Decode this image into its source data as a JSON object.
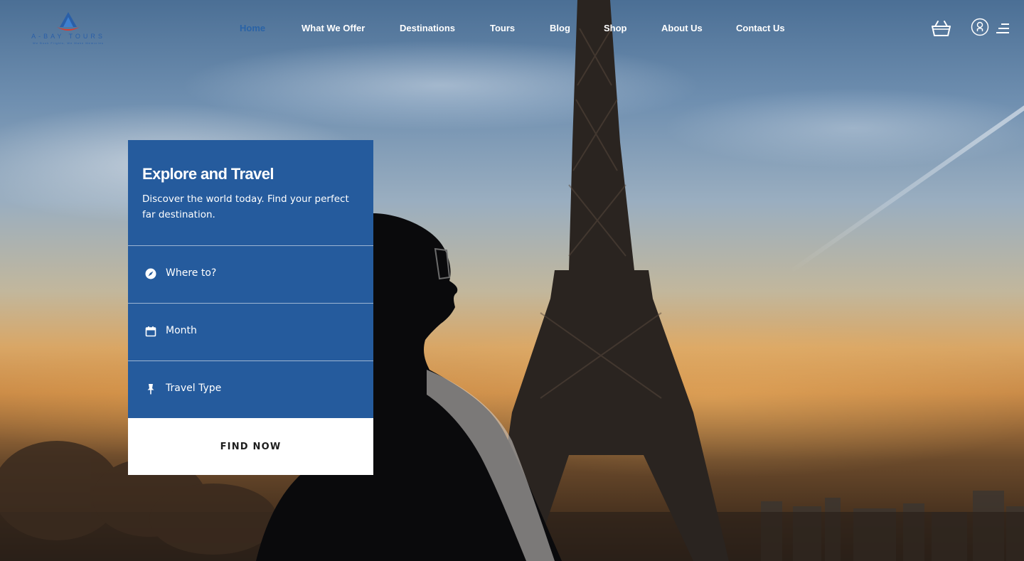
{
  "brand": {
    "name": "A-BAY TOURS",
    "tagline": "We Book Flights, We Make Memories"
  },
  "nav": {
    "items": [
      {
        "label": "Home",
        "active": true
      },
      {
        "label": "What We Offer",
        "active": false
      },
      {
        "label": "Destinations",
        "active": false
      },
      {
        "label": "Tours",
        "active": false
      },
      {
        "label": "Blog",
        "active": false
      },
      {
        "label": "Shop",
        "active": false
      },
      {
        "label": "About Us",
        "active": false
      },
      {
        "label": "Contact Us",
        "active": false
      }
    ],
    "icons": [
      "basket-icon",
      "user-icon",
      "menu-icon"
    ]
  },
  "search": {
    "title": "Explore and Travel",
    "description": "Discover the world today. Find your perfect far destination.",
    "fields": [
      {
        "label": "Where to?",
        "icon": "compass-icon"
      },
      {
        "label": "Month",
        "icon": "calendar-icon"
      },
      {
        "label": "Travel Type",
        "icon": "pin-icon"
      }
    ],
    "submit_label": "FIND NOW"
  },
  "colors": {
    "accent": "#255b9d",
    "nav_active": "#2a63a6",
    "nav_text": "#ffffff",
    "button_bg": "#ffffff"
  }
}
